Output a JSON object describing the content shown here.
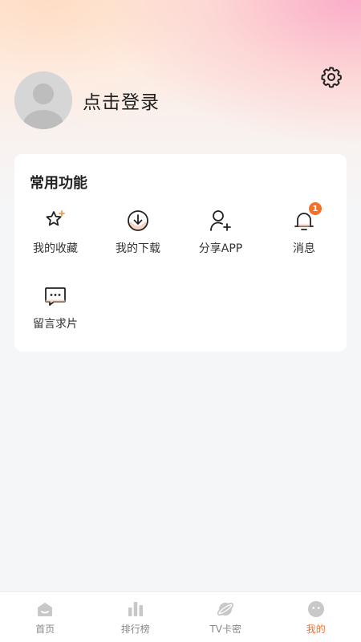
{
  "profile": {
    "login_label": "点击登录"
  },
  "functions": {
    "title": "常用功能",
    "items": [
      {
        "label": "我的收藏",
        "icon": "star-icon"
      },
      {
        "label": "我的下载",
        "icon": "download-icon"
      },
      {
        "label": "分享APP",
        "icon": "share-user-icon"
      },
      {
        "label": "消息",
        "icon": "bell-icon",
        "badge": "1"
      },
      {
        "label": "留言求片",
        "icon": "message-icon"
      }
    ]
  },
  "tabs": [
    {
      "label": "首页",
      "icon": "home-icon",
      "active": false
    },
    {
      "label": "排行榜",
      "icon": "ranking-icon",
      "active": false
    },
    {
      "label": "TV卡密",
      "icon": "planet-icon",
      "active": false
    },
    {
      "label": "我的",
      "icon": "face-icon",
      "active": true
    }
  ],
  "colors": {
    "accent": "#f7702a",
    "badge": "#f7702a",
    "inactive_tab": "#c8c8c8"
  }
}
